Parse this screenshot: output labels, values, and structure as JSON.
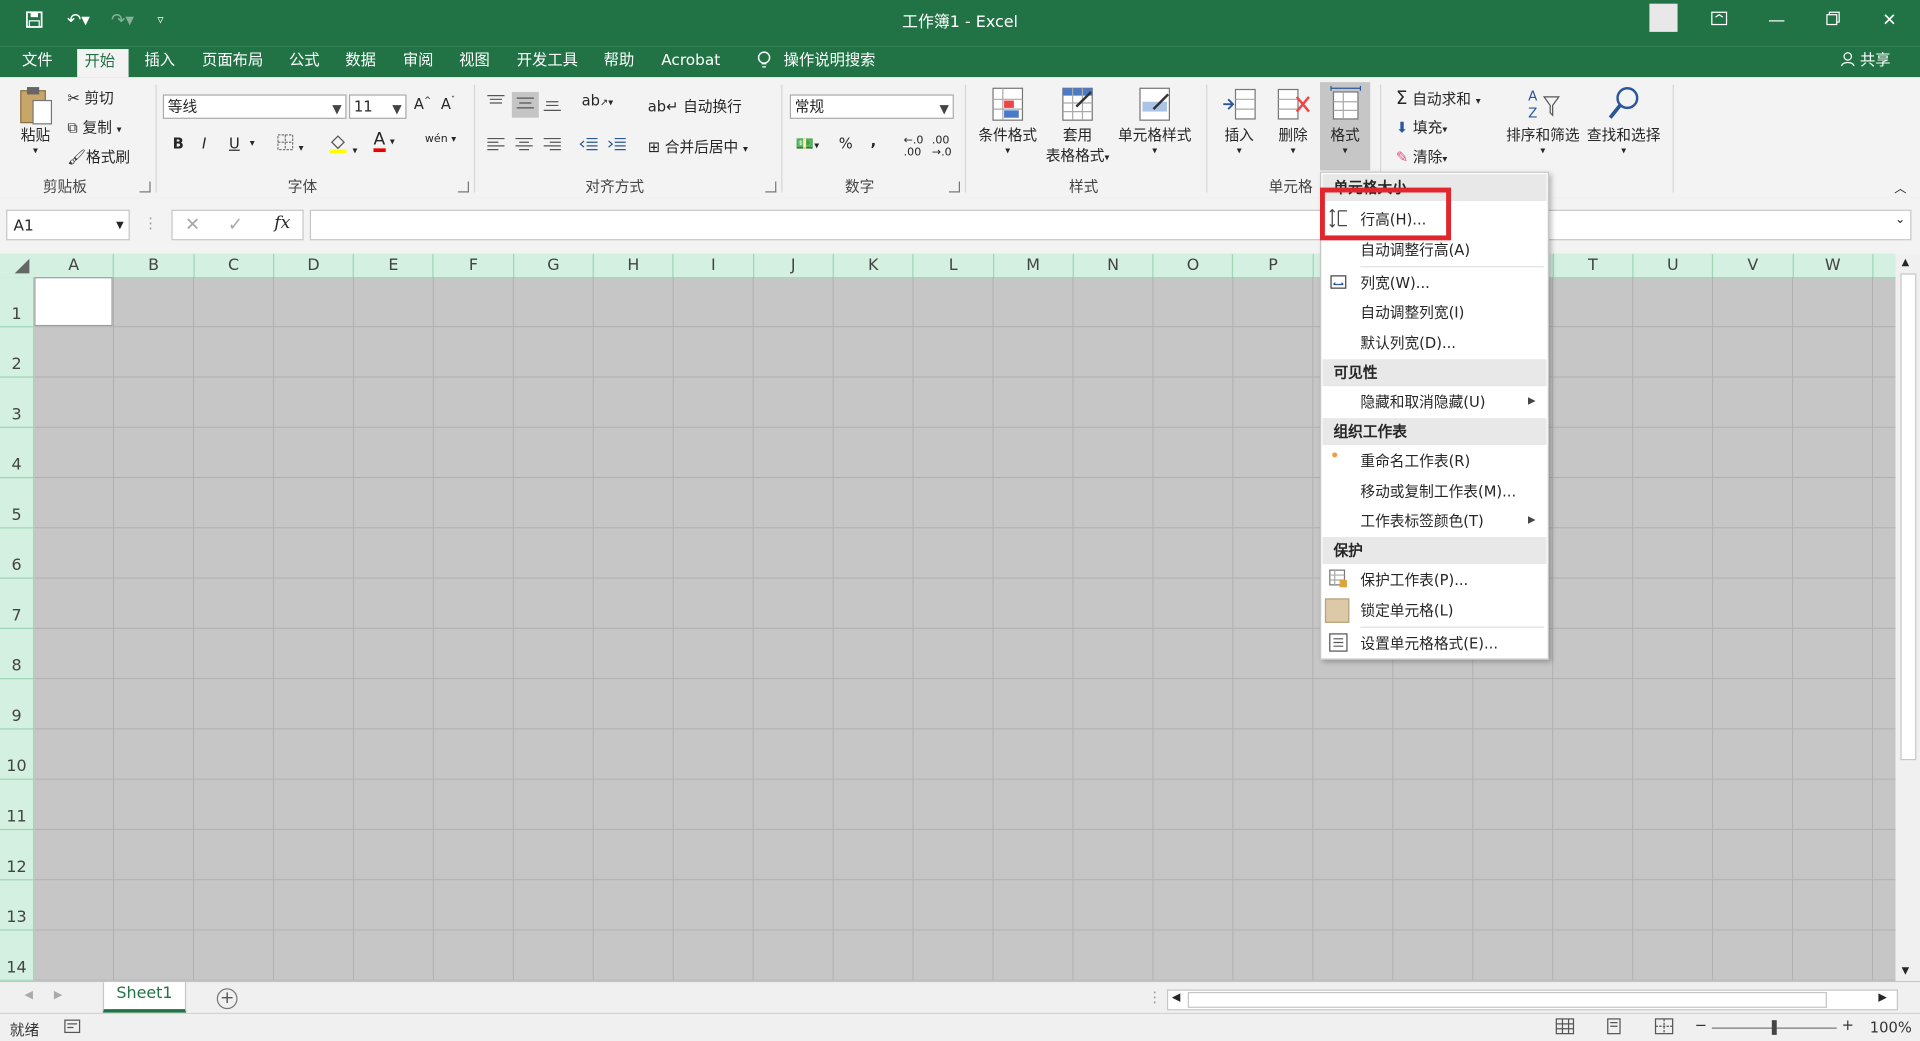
{
  "window": {
    "title": "工作簿1  -  Excel"
  },
  "tabs": [
    "文件",
    "开始",
    "插入",
    "页面布局",
    "公式",
    "数据",
    "审阅",
    "视图",
    "开发工具",
    "帮助",
    "Acrobat"
  ],
  "search_label": "操作说明搜索",
  "share_label": "共享",
  "clipboard": {
    "paste": "粘贴",
    "cut": "剪切",
    "copy": "复制",
    "format_painter": "格式刷",
    "group": "剪贴板"
  },
  "font": {
    "name": "等线",
    "size": "11",
    "group": "字体",
    "bold": "B",
    "italic": "I",
    "underline": "U",
    "font_color_glyph": "A",
    "phonetic_glyph": "wén"
  },
  "alignment": {
    "wrap": "自动换行",
    "merge": "合并后居中",
    "group": "对齐方式"
  },
  "number": {
    "format": "常规",
    "group": "数字",
    "percent": "%",
    "comma": ","
  },
  "styles": {
    "conditional_format": "条件格式",
    "table_format_line1": "套用",
    "table_format_line2": "表格格式",
    "cell_styles": "单元格样式",
    "group": "样式"
  },
  "cells": {
    "insert": "插入",
    "delete": "删除",
    "format": "格式",
    "group": "单元格"
  },
  "editing": {
    "autosum": "自动求和",
    "fill": "填充",
    "clear": "清除",
    "sort_filter": "排序和筛选",
    "find_select": "查找和选择"
  },
  "formula_bar": {
    "name_box": "A1",
    "fx": "fx"
  },
  "columns": [
    "A",
    "B",
    "C",
    "D",
    "E",
    "F",
    "G",
    "H",
    "I",
    "J",
    "K",
    "L",
    "M",
    "N",
    "O",
    "P",
    "Q",
    "R",
    "S",
    "T",
    "U",
    "V",
    "W"
  ],
  "rows": [
    "1",
    "2",
    "3",
    "4",
    "5",
    "6",
    "7",
    "8",
    "9",
    "10",
    "11",
    "12",
    "13",
    "14"
  ],
  "sheet_tab": "Sheet1",
  "status": {
    "ready": "就绪",
    "zoom": "100%"
  },
  "menu": {
    "header_cell_size": "单元格大小",
    "row_height": "行高(H)...",
    "autofit_row": "自动调整行高(A)",
    "col_width": "列宽(W)...",
    "autofit_col": "自动调整列宽(I)",
    "default_width": "默认列宽(D)...",
    "header_visibility": "可见性",
    "hide_unhide": "隐藏和取消隐藏(U)",
    "header_organize": "组织工作表",
    "rename": "重命名工作表(R)",
    "move_copy": "移动或复制工作表(M)...",
    "tab_color": "工作表标签颜色(T)",
    "header_protect": "保护",
    "protect_sheet": "保护工作表(P)...",
    "lock_cell": "锁定单元格(L)",
    "format_cells": "设置单元格格式(E)..."
  },
  "colors": {
    "brand": "#217346",
    "highlight": "#e1262d"
  }
}
